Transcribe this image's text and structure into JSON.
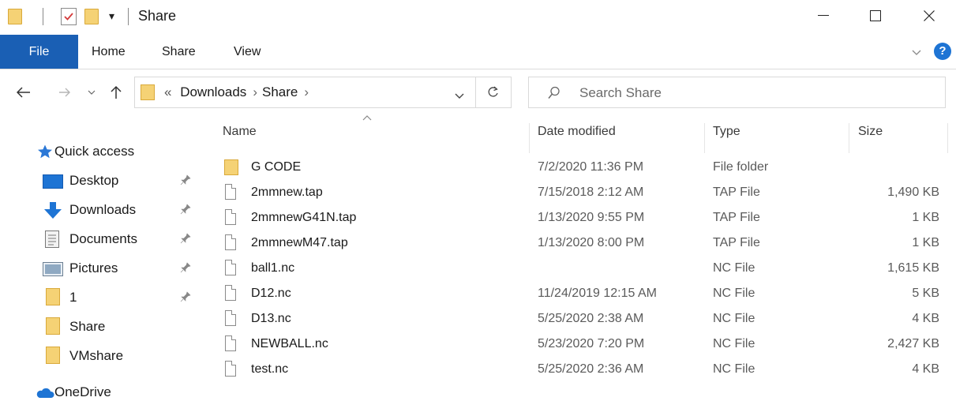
{
  "window": {
    "title": "Share",
    "qat_dropdown_glyph": "▾"
  },
  "ribbon": {
    "tabs": [
      {
        "label": "File",
        "active": true
      },
      {
        "label": "Home"
      },
      {
        "label": "Share"
      },
      {
        "label": "View"
      }
    ],
    "help_glyph": "?"
  },
  "address": {
    "overflow_glyph": "«",
    "crumbs": [
      "Downloads",
      "Share"
    ],
    "separator": "›"
  },
  "search": {
    "placeholder": "Search Share",
    "value": ""
  },
  "navpane": {
    "quick_access": "Quick access",
    "items": [
      {
        "label": "Desktop",
        "icon": "desktop-icon",
        "pinned": true
      },
      {
        "label": "Downloads",
        "icon": "download-arrow-icon",
        "pinned": true
      },
      {
        "label": "Documents",
        "icon": "documents-icon",
        "pinned": true
      },
      {
        "label": "Pictures",
        "icon": "pictures-icon",
        "pinned": true
      },
      {
        "label": "1",
        "icon": "folder-icon",
        "pinned": true
      },
      {
        "label": "Share",
        "icon": "folder-icon",
        "pinned": false
      },
      {
        "label": "VMshare",
        "icon": "folder-icon",
        "pinned": false
      }
    ],
    "onedrive": "OneDrive"
  },
  "filelist": {
    "columns": {
      "name": "Name",
      "date": "Date modified",
      "type": "Type",
      "size": "Size"
    },
    "rows": [
      {
        "name": "G CODE",
        "date": "7/2/2020 11:36 PM",
        "type": "File folder",
        "size": "",
        "kind": "folder"
      },
      {
        "name": "2mmnew.tap",
        "date": "7/15/2018 2:12 AM",
        "type": "TAP File",
        "size": "1,490 KB",
        "kind": "file"
      },
      {
        "name": "2mmnewG41N.tap",
        "date": "1/13/2020 9:55 PM",
        "type": "TAP File",
        "size": "1 KB",
        "kind": "file"
      },
      {
        "name": "2mmnewM47.tap",
        "date": "1/13/2020 8:00 PM",
        "type": "TAP File",
        "size": "1 KB",
        "kind": "file"
      },
      {
        "name": "ball1.nc",
        "date": "",
        "type": "NC File",
        "size": "1,615 KB",
        "kind": "file"
      },
      {
        "name": "D12.nc",
        "date": "11/24/2019 12:15 AM",
        "type": "NC File",
        "size": "5 KB",
        "kind": "file"
      },
      {
        "name": "D13.nc",
        "date": "5/25/2020 2:38 AM",
        "type": "NC File",
        "size": "4 KB",
        "kind": "file"
      },
      {
        "name": "NEWBALL.nc",
        "date": "5/23/2020 7:20 PM",
        "type": "NC File",
        "size": "2,427 KB",
        "kind": "file"
      },
      {
        "name": "test.nc",
        "date": "5/25/2020 2:36 AM",
        "type": "NC File",
        "size": "4 KB",
        "kind": "file"
      }
    ]
  },
  "colors": {
    "file_tab": "#1a5fb4",
    "folder": "#f5d275",
    "help": "#1e74d4",
    "quick_access_star": "#2b78d6"
  }
}
